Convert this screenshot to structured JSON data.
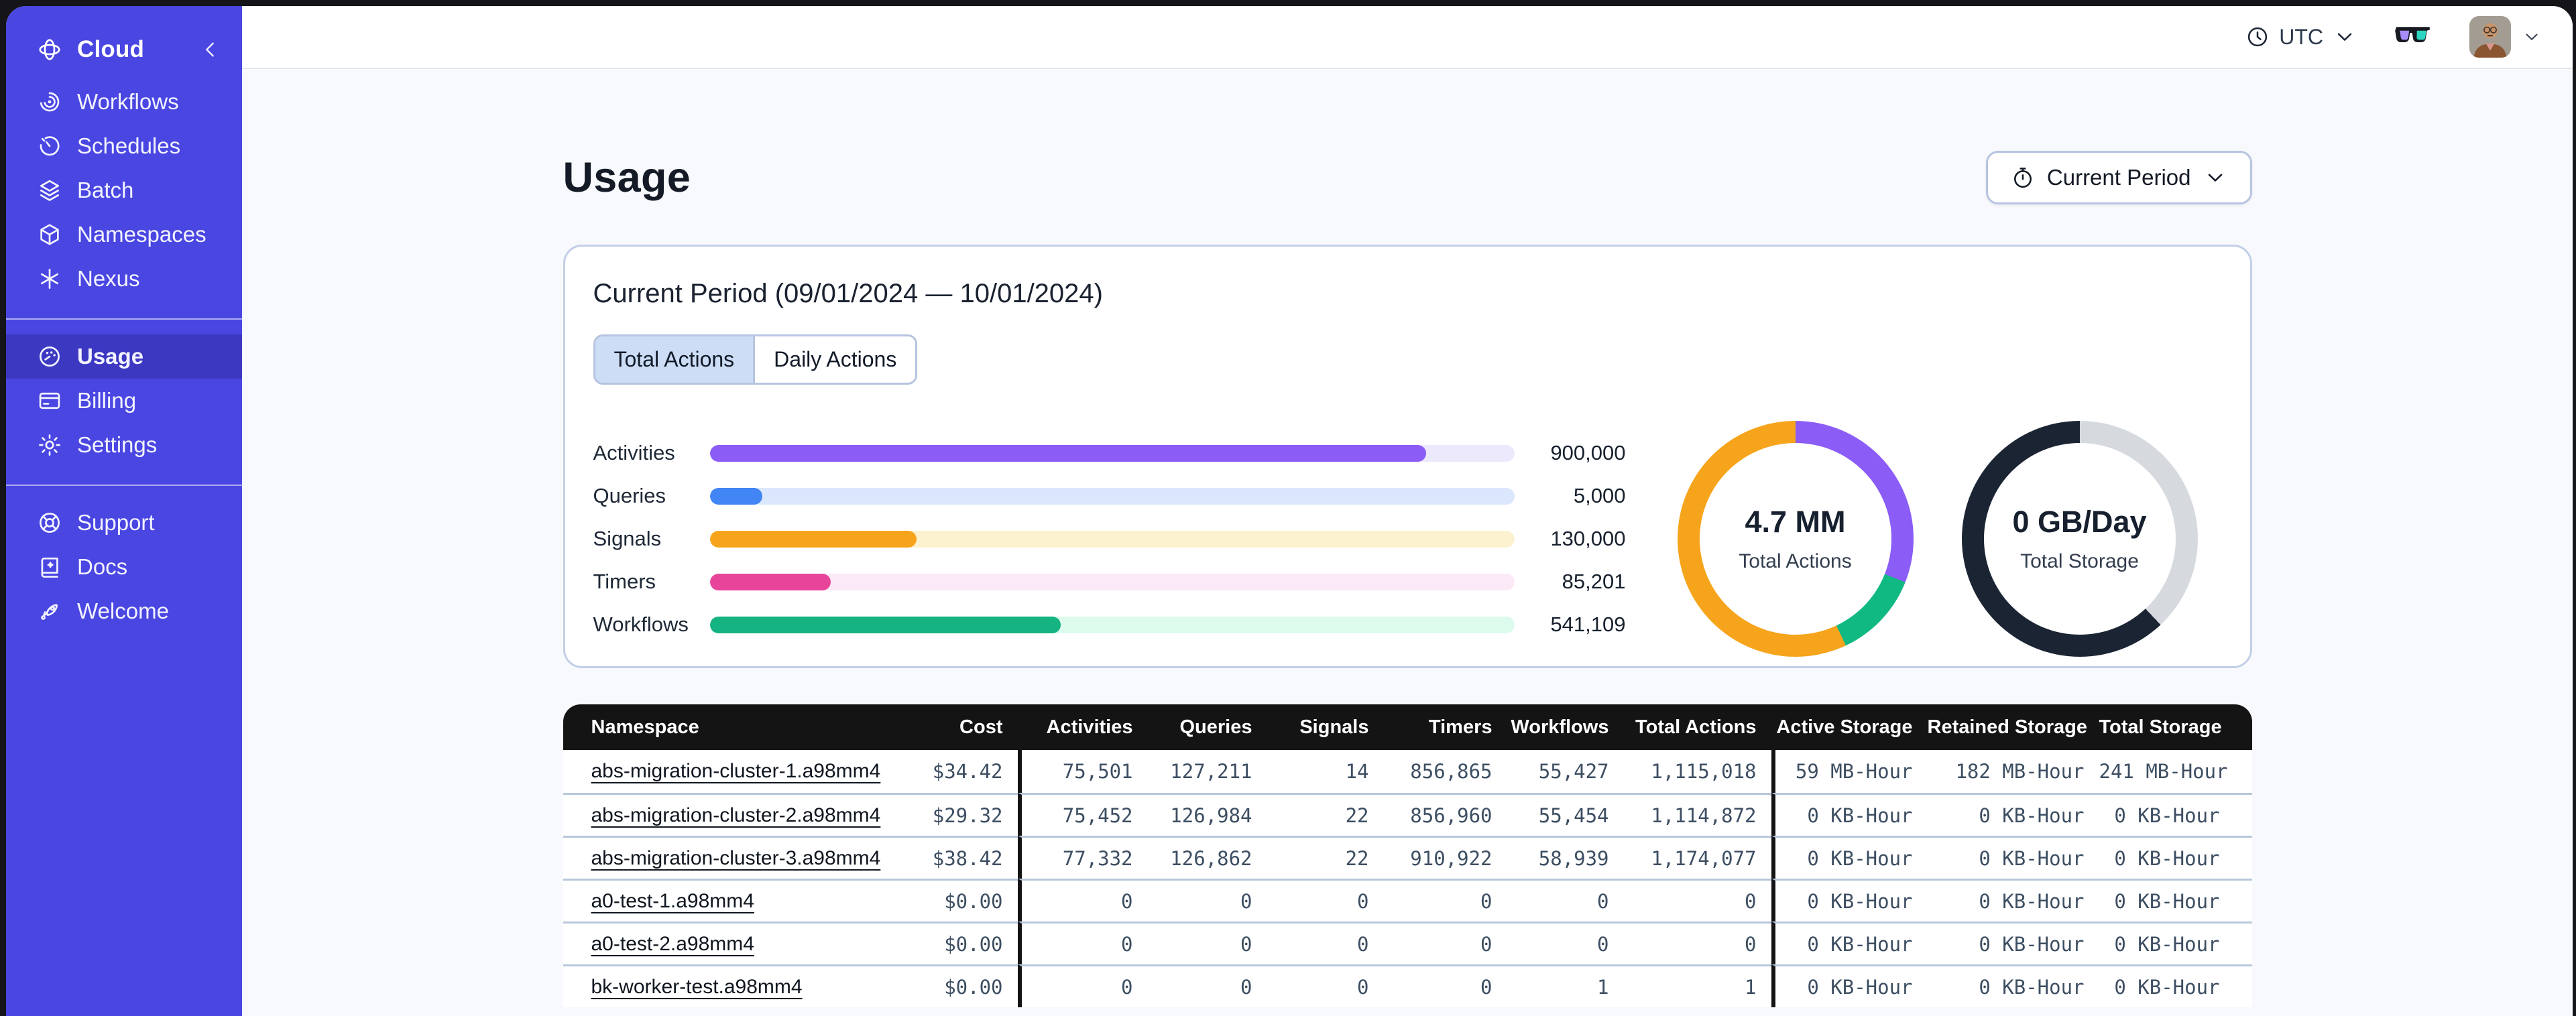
{
  "sidebar": {
    "brand": "Cloud",
    "groups": [
      {
        "items": [
          {
            "icon": "workflows",
            "label": "Workflows",
            "active": false
          },
          {
            "icon": "schedules",
            "label": "Schedules",
            "active": false
          },
          {
            "icon": "batch",
            "label": "Batch",
            "active": false
          },
          {
            "icon": "namespaces",
            "label": "Namespaces",
            "active": false
          },
          {
            "icon": "nexus",
            "label": "Nexus",
            "active": false
          }
        ]
      },
      {
        "items": [
          {
            "icon": "usage",
            "label": "Usage",
            "active": true
          },
          {
            "icon": "billing",
            "label": "Billing",
            "active": false
          },
          {
            "icon": "settings",
            "label": "Settings",
            "active": false
          }
        ]
      },
      {
        "items": [
          {
            "icon": "support",
            "label": "Support",
            "active": false
          },
          {
            "icon": "docs",
            "label": "Docs",
            "active": false
          },
          {
            "icon": "welcome",
            "label": "Welcome",
            "active": false
          }
        ]
      }
    ]
  },
  "header": {
    "timezone_label": "UTC"
  },
  "page": {
    "title": "Usage",
    "period_selector": {
      "label": "Current Period"
    }
  },
  "usage_card": {
    "title": "Current Period (09/01/2024 — 10/01/2024)",
    "tabs": [
      {
        "label": "Total Actions",
        "active": true
      },
      {
        "label": "Daily Actions",
        "active": false
      }
    ],
    "chart_data": {
      "type": "bar",
      "categories": [
        "Activities",
        "Queries",
        "Signals",
        "Timers",
        "Workflows"
      ],
      "values": [
        900000,
        5000,
        130000,
        85201,
        541109
      ],
      "display_values": [
        "900,000",
        "5,000",
        "130,000",
        "85,201",
        "541,109"
      ],
      "fill_percents": [
        89,
        6.5,
        25.7,
        15,
        43.6
      ],
      "colors": [
        "#8b5cf6",
        "#4285f4",
        "#f6a41b",
        "#e8459a",
        "#14b381"
      ],
      "track_colors": [
        "#ede9fd",
        "#dbe7fc",
        "#fdf2cf",
        "#fce9f7",
        "#dcfbec"
      ]
    },
    "donuts": [
      {
        "value": "4.7 MM",
        "label": "Total Actions",
        "segments": [
          {
            "name": "activities",
            "color": "#8b5cf6",
            "pct": 31
          },
          {
            "name": "workflows",
            "color": "#10b981",
            "pct": 12
          },
          {
            "name": "signals",
            "color": "#f6a41b",
            "pct": 57
          }
        ]
      },
      {
        "value": "0 GB/Day",
        "label": "Total Storage",
        "segments": [
          {
            "name": "remaining",
            "color": "#d6dade",
            "pct": 38
          },
          {
            "name": "used",
            "color": "#1b2433",
            "pct": 62
          }
        ]
      }
    ]
  },
  "table": {
    "columns": [
      "Namespace",
      "Cost",
      "Activities",
      "Queries",
      "Signals",
      "Timers",
      "Workflows",
      "Total Actions",
      "Active Storage",
      "Retained Storage",
      "Total Storage"
    ],
    "rows": [
      [
        "abs-migration-cluster-1.a98mm4",
        "$34.42",
        "75,501",
        "127,211",
        "14",
        "856,865",
        "55,427",
        "1,115,018",
        "59 MB-Hour",
        "182 MB-Hour",
        "241 MB-Hour"
      ],
      [
        "abs-migration-cluster-2.a98mm4",
        "$29.32",
        "75,452",
        "126,984",
        "22",
        "856,960",
        "55,454",
        "1,114,872",
        "0 KB-Hour",
        "0 KB-Hour",
        "0 KB-Hour"
      ],
      [
        "abs-migration-cluster-3.a98mm4",
        "$38.42",
        "77,332",
        "126,862",
        "22",
        "910,922",
        "58,939",
        "1,174,077",
        "0 KB-Hour",
        "0 KB-Hour",
        "0 KB-Hour"
      ],
      [
        "a0-test-1.a98mm4",
        "$0.00",
        "0",
        "0",
        "0",
        "0",
        "0",
        "0",
        "0 KB-Hour",
        "0 KB-Hour",
        "0 KB-Hour"
      ],
      [
        "a0-test-2.a98mm4",
        "$0.00",
        "0",
        "0",
        "0",
        "0",
        "0",
        "0",
        "0 KB-Hour",
        "0 KB-Hour",
        "0 KB-Hour"
      ],
      [
        "bk-worker-test.a98mm4",
        "$0.00",
        "0",
        "0",
        "0",
        "0",
        "1",
        "1",
        "0 KB-Hour",
        "0 KB-Hour",
        "0 KB-Hour"
      ]
    ]
  }
}
